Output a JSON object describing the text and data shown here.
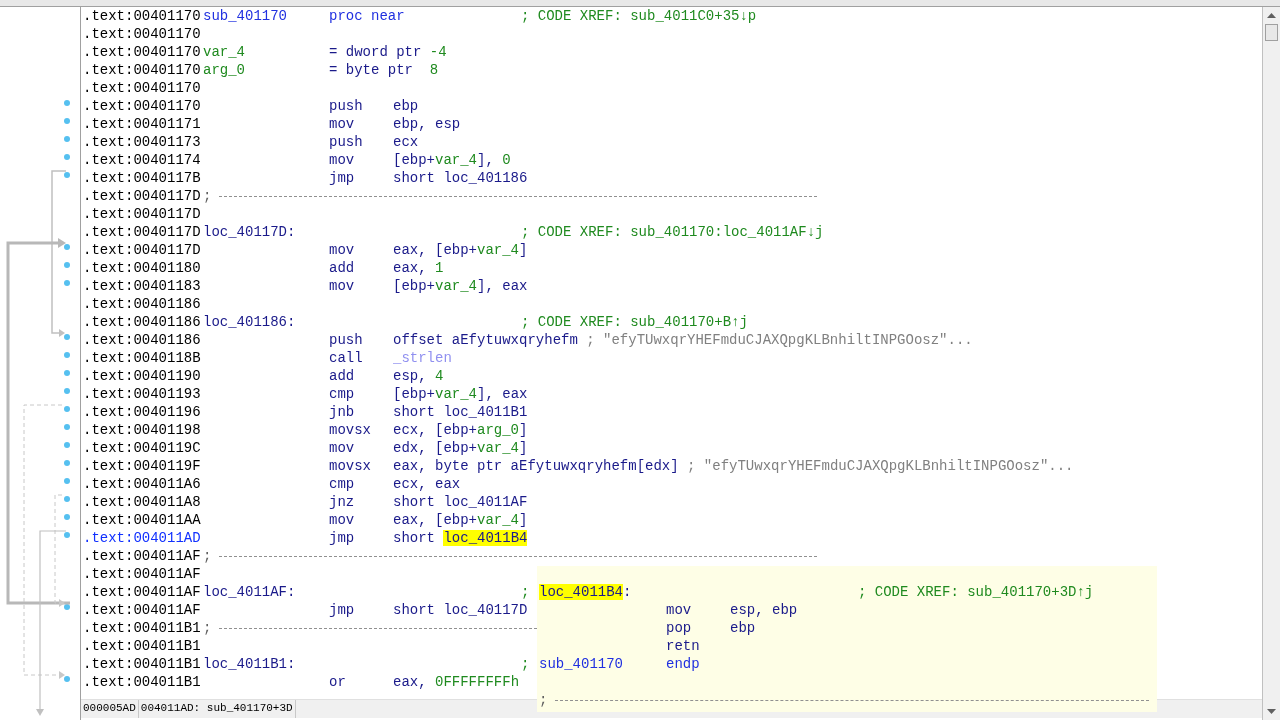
{
  "listing": {
    "lines": [
      {
        "address": ".text:00401170",
        "current": false,
        "dot": false,
        "kind": "code",
        "label": [
          {
            "text": "sub_401170",
            "kind": "proc"
          }
        ],
        "decl": [
          {
            "text": "proc near",
            "kind": "proc"
          }
        ],
        "comment": {
          "text": "; CODE XREF: sub_4011C0+35↓p",
          "kind": "xref"
        }
      },
      {
        "address": ".text:00401170",
        "current": false,
        "dot": false,
        "kind": "code"
      },
      {
        "address": ".text:00401170",
        "current": false,
        "dot": false,
        "kind": "code",
        "label": [
          {
            "text": "var_4",
            "kind": "var"
          }
        ],
        "decl": [
          {
            "text": "= dword ptr ",
            "kind": "plain"
          },
          {
            "text": "-4",
            "kind": "num"
          }
        ]
      },
      {
        "address": ".text:00401170",
        "current": false,
        "dot": false,
        "kind": "code",
        "label": [
          {
            "text": "arg_0",
            "kind": "var"
          }
        ],
        "decl": [
          {
            "text": "= byte ptr  ",
            "kind": "plain"
          },
          {
            "text": "8",
            "kind": "num"
          }
        ]
      },
      {
        "address": ".text:00401170",
        "current": false,
        "dot": false,
        "kind": "code"
      },
      {
        "address": ".text:00401170",
        "current": false,
        "dot": true,
        "kind": "code",
        "mnemonic": "push",
        "operands": [
          {
            "text": "ebp",
            "kind": "plain"
          }
        ]
      },
      {
        "address": ".text:00401171",
        "current": false,
        "dot": true,
        "kind": "code",
        "mnemonic": "mov",
        "operands": [
          {
            "text": "ebp, esp",
            "kind": "plain"
          }
        ]
      },
      {
        "address": ".text:00401173",
        "current": false,
        "dot": true,
        "kind": "code",
        "mnemonic": "push",
        "operands": [
          {
            "text": "ecx",
            "kind": "plain"
          }
        ]
      },
      {
        "address": ".text:00401174",
        "current": false,
        "dot": true,
        "kind": "code",
        "mnemonic": "mov",
        "operands": [
          {
            "text": "[ebp+",
            "kind": "plain"
          },
          {
            "text": "var_4",
            "kind": "var"
          },
          {
            "text": "], ",
            "kind": "plain"
          },
          {
            "text": "0",
            "kind": "num"
          }
        ]
      },
      {
        "address": ".text:0040117B",
        "current": false,
        "dot": true,
        "kind": "code",
        "mnemonic": "jmp",
        "operands": [
          {
            "text": "short loc_401186",
            "kind": "plain"
          }
        ]
      },
      {
        "address": ".text:0040117D",
        "current": false,
        "dot": false,
        "kind": "separator",
        "text": ";"
      },
      {
        "address": ".text:0040117D",
        "current": false,
        "dot": false,
        "kind": "code"
      },
      {
        "address": ".text:0040117D",
        "current": false,
        "dot": false,
        "kind": "code",
        "label": [
          {
            "text": "loc_40117D:",
            "kind": "plain"
          }
        ],
        "comment": {
          "text": "; CODE XREF: sub_401170:loc_4011AF↓j",
          "kind": "xref"
        }
      },
      {
        "address": ".text:0040117D",
        "current": false,
        "dot": true,
        "kind": "code",
        "mnemonic": "mov",
        "operands": [
          {
            "text": "eax, [ebp+",
            "kind": "plain"
          },
          {
            "text": "var_4",
            "kind": "var"
          },
          {
            "text": "]",
            "kind": "plain"
          }
        ]
      },
      {
        "address": ".text:00401180",
        "current": false,
        "dot": true,
        "kind": "code",
        "mnemonic": "add",
        "operands": [
          {
            "text": "eax, ",
            "kind": "plain"
          },
          {
            "text": "1",
            "kind": "num"
          }
        ]
      },
      {
        "address": ".text:00401183",
        "current": false,
        "dot": true,
        "kind": "code",
        "mnemonic": "mov",
        "operands": [
          {
            "text": "[ebp+",
            "kind": "plain"
          },
          {
            "text": "var_4",
            "kind": "var"
          },
          {
            "text": "], eax",
            "kind": "plain"
          }
        ]
      },
      {
        "address": ".text:00401186",
        "current": false,
        "dot": false,
        "kind": "code"
      },
      {
        "address": ".text:00401186",
        "current": false,
        "dot": false,
        "kind": "code",
        "label": [
          {
            "text": "loc_401186:",
            "kind": "plain"
          }
        ],
        "comment": {
          "text": "; CODE XREF: sub_401170+B↑j",
          "kind": "xref"
        }
      },
      {
        "address": ".text:00401186",
        "current": false,
        "dot": true,
        "kind": "code",
        "mnemonic": "push",
        "operands": [
          {
            "text": "offset aEfytuwxqryhefm ",
            "kind": "plain"
          }
        ],
        "comment": {
          "text": "; \"efyTUwxqrYHEFmduCJAXQpgKLBnhiltINPGOosz\"...",
          "kind": "string"
        }
      },
      {
        "address": ".text:0040118B",
        "current": false,
        "dot": true,
        "kind": "code",
        "mnemonic": "call",
        "operands": [
          {
            "text": "_strlen",
            "kind": "import"
          }
        ]
      },
      {
        "address": ".text:00401190",
        "current": false,
        "dot": true,
        "kind": "code",
        "mnemonic": "add",
        "operands": [
          {
            "text": "esp, ",
            "kind": "plain"
          },
          {
            "text": "4",
            "kind": "num"
          }
        ]
      },
      {
        "address": ".text:00401193",
        "current": false,
        "dot": true,
        "kind": "code",
        "mnemonic": "cmp",
        "operands": [
          {
            "text": "[ebp+",
            "kind": "plain"
          },
          {
            "text": "var_4",
            "kind": "var"
          },
          {
            "text": "], eax",
            "kind": "plain"
          }
        ]
      },
      {
        "address": ".text:00401196",
        "current": false,
        "dot": true,
        "kind": "code",
        "mnemonic": "jnb",
        "operands": [
          {
            "text": "short loc_4011B1",
            "kind": "plain"
          }
        ]
      },
      {
        "address": ".text:00401198",
        "current": false,
        "dot": true,
        "kind": "code",
        "mnemonic": "movsx",
        "operands": [
          {
            "text": "ecx, [ebp+",
            "kind": "plain"
          },
          {
            "text": "arg_0",
            "kind": "var"
          },
          {
            "text": "]",
            "kind": "plain"
          }
        ]
      },
      {
        "address": ".text:0040119C",
        "current": false,
        "dot": true,
        "kind": "code",
        "mnemonic": "mov",
        "operands": [
          {
            "text": "edx, [ebp+",
            "kind": "plain"
          },
          {
            "text": "var_4",
            "kind": "var"
          },
          {
            "text": "]",
            "kind": "plain"
          }
        ]
      },
      {
        "address": ".text:0040119F",
        "current": false,
        "dot": true,
        "kind": "code",
        "mnemonic": "movsx",
        "operands": [
          {
            "text": "eax, byte ptr aEfytuwxqryhefm[edx] ",
            "kind": "plain"
          }
        ],
        "comment": {
          "text": "; \"efyTUwxqrYHEFmduCJAXQpgKLBnhiltINPGOosz\"...",
          "kind": "string"
        }
      },
      {
        "address": ".text:004011A6",
        "current": false,
        "dot": true,
        "kind": "code",
        "mnemonic": "cmp",
        "operands": [
          {
            "text": "ecx, eax",
            "kind": "plain"
          }
        ]
      },
      {
        "address": ".text:004011A8",
        "current": false,
        "dot": true,
        "kind": "code",
        "mnemonic": "jnz",
        "operands": [
          {
            "text": "short loc_4011AF",
            "kind": "plain"
          }
        ]
      },
      {
        "address": ".text:004011AA",
        "current": false,
        "dot": true,
        "kind": "code",
        "mnemonic": "mov",
        "operands": [
          {
            "text": "eax, [ebp+",
            "kind": "plain"
          },
          {
            "text": "var_4",
            "kind": "var"
          },
          {
            "text": "]",
            "kind": "plain"
          }
        ]
      },
      {
        "address": ".text:004011AD",
        "current": true,
        "dot": true,
        "kind": "code",
        "mnemonic": "jmp",
        "operands": [
          {
            "text": "short ",
            "kind": "plain"
          },
          {
            "text": "loc_4011B4",
            "kind": "hl"
          }
        ]
      },
      {
        "address": ".text:004011AF",
        "current": false,
        "dot": false,
        "kind": "separator",
        "text": ";"
      },
      {
        "address": ".text:004011AF",
        "current": false,
        "dot": false,
        "kind": "code"
      },
      {
        "address": ".text:004011AF",
        "current": false,
        "dot": false,
        "kind": "code",
        "label": [
          {
            "text": "loc_4011AF:",
            "kind": "plain"
          }
        ],
        "comment": {
          "text": ";",
          "kind": "xref"
        }
      },
      {
        "address": ".text:004011AF",
        "current": false,
        "dot": true,
        "kind": "code",
        "mnemonic": "jmp",
        "operands": [
          {
            "text": "short loc_40117D",
            "kind": "plain"
          }
        ]
      },
      {
        "address": ".text:004011B1",
        "current": false,
        "dot": false,
        "kind": "separator",
        "text": ";"
      },
      {
        "address": ".text:004011B1",
        "current": false,
        "dot": false,
        "kind": "code"
      },
      {
        "address": ".text:004011B1",
        "current": false,
        "dot": false,
        "kind": "code",
        "label": [
          {
            "text": "loc_4011B1:",
            "kind": "plain"
          }
        ],
        "comment": {
          "text": ";",
          "kind": "xref"
        }
      },
      {
        "address": ".text:004011B1",
        "current": false,
        "dot": true,
        "kind": "code",
        "mnemonic": "or",
        "operands": [
          {
            "text": "eax, ",
            "kind": "plain"
          },
          {
            "text": "0FFFFFFFFh",
            "kind": "num"
          }
        ]
      }
    ]
  },
  "tooltip": {
    "lines": [
      {
        "kind": "code",
        "label": [
          {
            "text": "loc_4011B4",
            "kind": "hl"
          },
          {
            "text": ":",
            "kind": "plain"
          }
        ],
        "comment": {
          "text": "; CODE XREF: sub_401170+3D↑j",
          "kind": "xref"
        }
      },
      {
        "kind": "code",
        "mnemonic": "mov",
        "operands": [
          {
            "text": "esp, ebp",
            "kind": "plain"
          }
        ]
      },
      {
        "kind": "code",
        "mnemonic": "pop",
        "operands": [
          {
            "text": "ebp",
            "kind": "plain"
          }
        ]
      },
      {
        "kind": "code",
        "mnemonic": "retn"
      },
      {
        "kind": "code",
        "label": [
          {
            "text": "sub_401170",
            "kind": "proc"
          }
        ],
        "decl": [
          {
            "text": "endp",
            "kind": "proc"
          }
        ]
      },
      {
        "kind": "code"
      },
      {
        "kind": "separator",
        "text": ";"
      }
    ]
  },
  "status_bar": {
    "offset": "000005AD",
    "location": "004011AD: sub_401170+3D"
  }
}
